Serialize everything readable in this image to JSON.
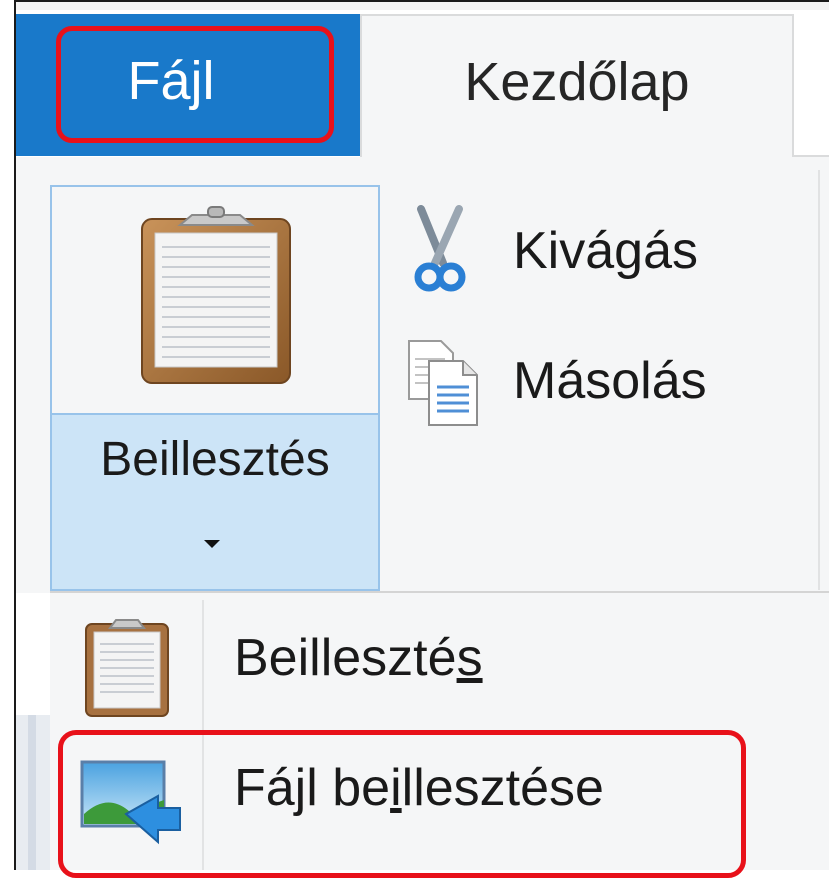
{
  "tabs": {
    "file_label": "Fájl",
    "home_label": "Kezdőlap"
  },
  "clipboard": {
    "paste_label": "Beillesztés",
    "cut_label": "Kivágás",
    "copy_label": "Másolás"
  },
  "paste_menu": {
    "items": [
      {
        "label_prefix": "Beillesztés",
        "label_prefix_trim": "Beilleszté",
        "access_key": "s",
        "label_suffix": ""
      },
      {
        "label_prefix": "Fájl be",
        "access_key": "i",
        "label_suffix": "llesztése"
      }
    ]
  },
  "colors": {
    "file_tab_bg": "#1979ca",
    "highlight": "#e8111a",
    "paste_hover": "#cce4f7"
  },
  "icons": {
    "paste": "clipboard-icon",
    "cut": "scissors-icon",
    "copy": "copy-icon",
    "paste_from": "image-arrow-icon"
  }
}
